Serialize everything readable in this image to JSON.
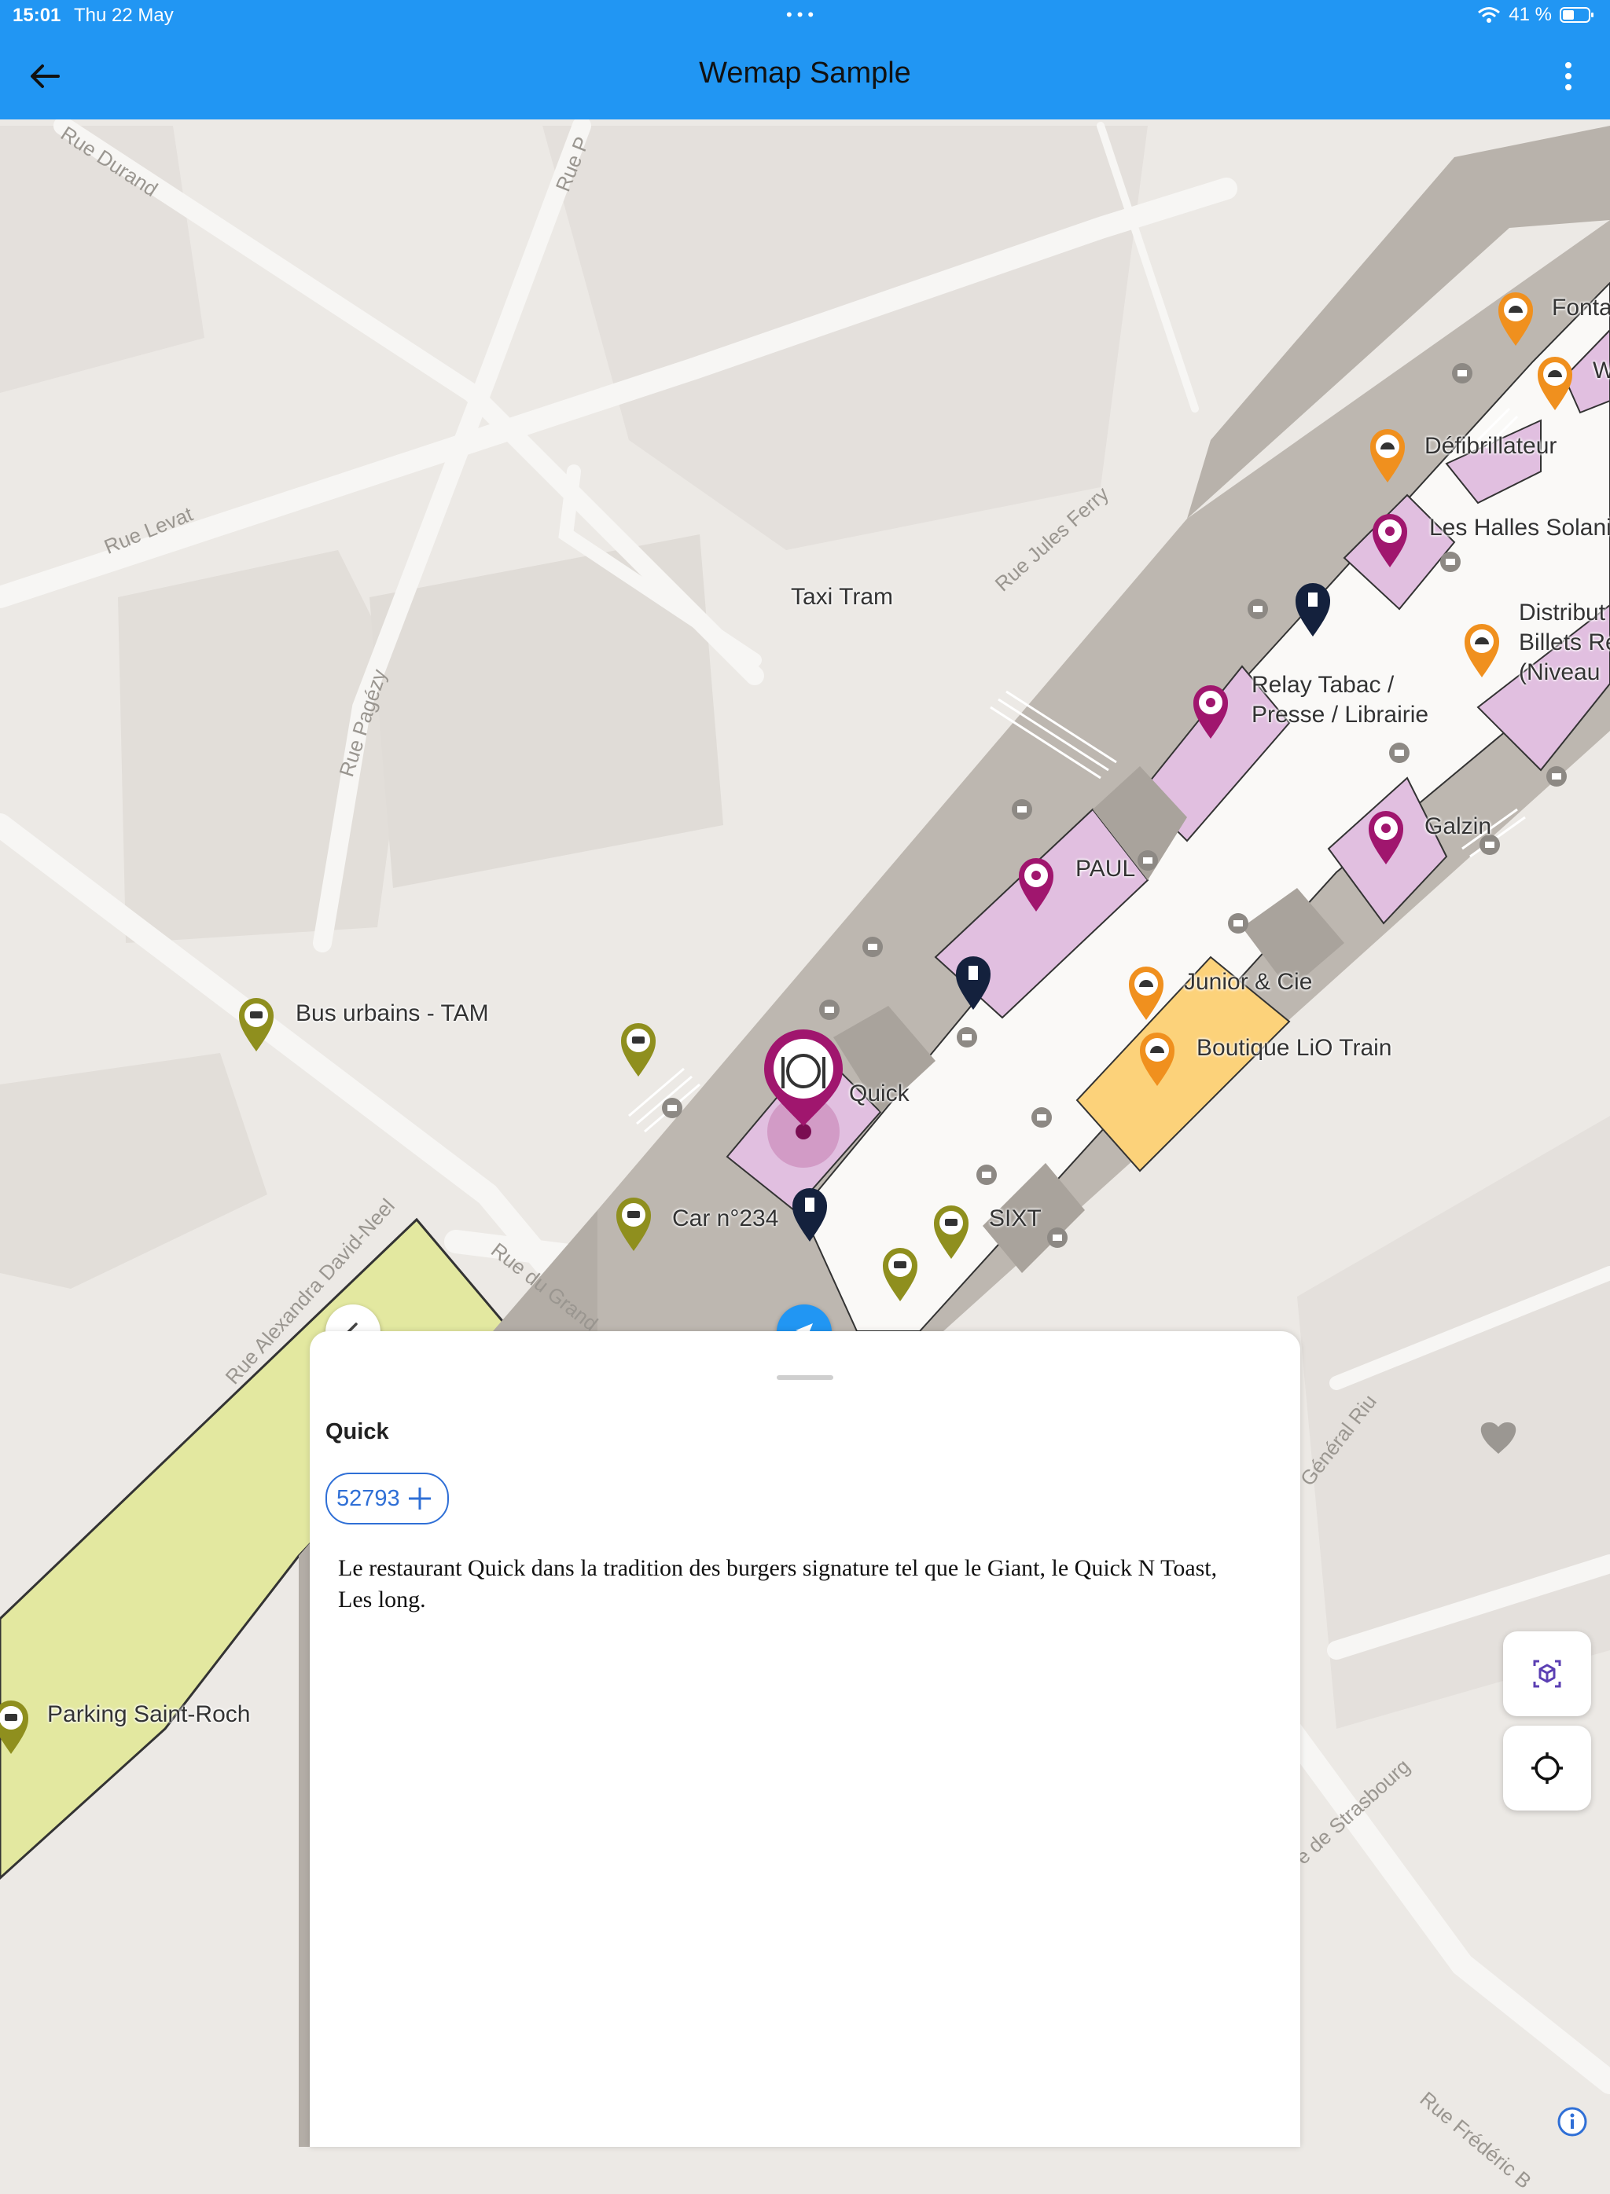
{
  "status_bar": {
    "time": "15:01",
    "date": "Thu 22 May",
    "battery": "41 %"
  },
  "app_bar": {
    "title": "Wemap Sample"
  },
  "map": {
    "poi_labels": {
      "taxi_tram": "Taxi Tram",
      "bus": "Bus urbains - TAM",
      "quick": "Quick",
      "car": "Car n°234",
      "sixt": "SIXT",
      "paul": "PAUL",
      "relay_1": "Relay Tabac /",
      "relay_2": "Presse / Librairie",
      "galzin": "Galzin",
      "junior": "Junior & Cie",
      "boutique": "Boutique LiO Train",
      "defib": "Défibrillateur",
      "halles": "Les Halles Solani",
      "distrib_1": "Distribut",
      "distrib_2": "Billets Re",
      "distrib_3": "(Niveau",
      "fonta": "Fonta",
      "w": "W",
      "parking": "Parking Saint-Roch"
    },
    "streets": {
      "durand": "Rue Durand",
      "levat": "Rue Levat",
      "pagezy": "Rue Pagézy",
      "jules_ferry": "Rue Jules Ferry",
      "david_neel": "Rue Alexandra David-Neel",
      "du_grand": "Rue du Grand",
      "general_riu": "Général Riu",
      "strasbourg": "e de Strasbourg",
      "frederic": "Rue Frédéric B",
      "rue_p": "Rue P"
    },
    "colors": {
      "shop_purple": "#e1bfe0",
      "shop_orange": "#fcd27a",
      "park_green": "#e3e8a0",
      "station": "#bdb7b0",
      "primary_blue": "#2196f3",
      "pin_magenta": "#a0166e"
    }
  },
  "sheet": {
    "title": "Quick",
    "chip_number": "52793",
    "description": "Le restaurant Quick dans la tradition des burgers signature tel que le Giant, le Quick N Toast, Les long."
  }
}
